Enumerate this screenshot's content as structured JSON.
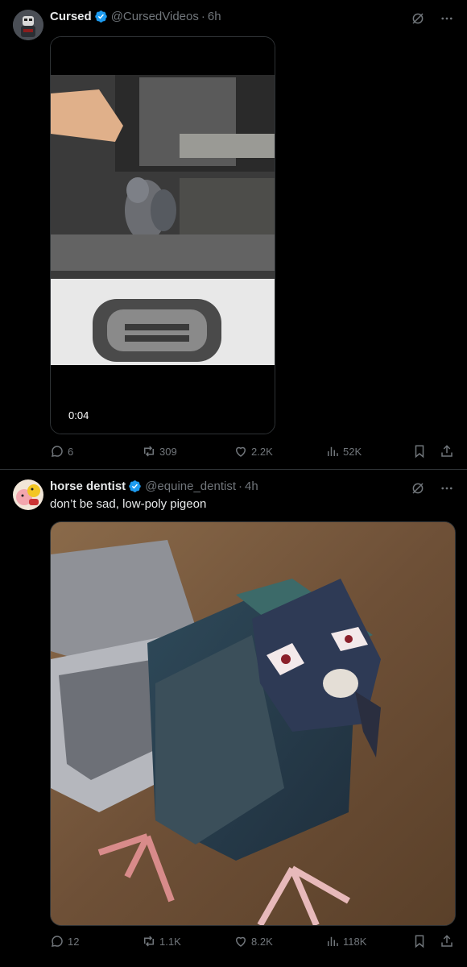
{
  "posts": [
    {
      "display_name": "Cursed",
      "handle": "@CursedVideos",
      "separator": "·",
      "time": "6h",
      "text": "",
      "media": {
        "type": "video",
        "duration": "0:04"
      },
      "actions": {
        "replies": "6",
        "reposts": "309",
        "likes": "2.2K",
        "views": "52K"
      }
    },
    {
      "display_name": "horse dentist",
      "handle": "@equine_dentist",
      "separator": "·",
      "time": "4h",
      "text": "don’t be sad, low-poly pigeon",
      "media": {
        "type": "image"
      },
      "actions": {
        "replies": "12",
        "reposts": "1.1K",
        "likes": "8.2K",
        "views": "118K"
      }
    }
  ],
  "colors": {
    "background": "#000000",
    "text": "#e7e9ea",
    "muted": "#71767b",
    "verified": "#1d9bf0",
    "divider": "#2f3336"
  },
  "icons": [
    "verified-badge-icon",
    "grok-icon",
    "more-icon",
    "reply-icon",
    "repost-icon",
    "like-icon",
    "views-icon",
    "bookmark-icon",
    "share-icon"
  ]
}
